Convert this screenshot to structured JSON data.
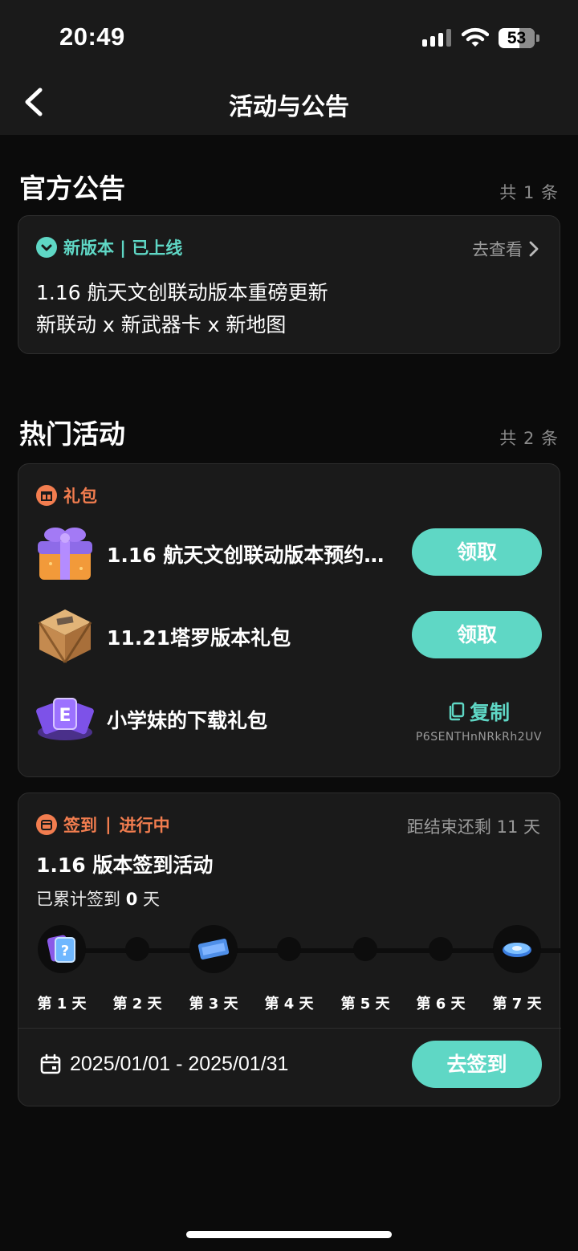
{
  "status_bar": {
    "time": "20:49",
    "battery": "53"
  },
  "header": {
    "title": "活动与公告"
  },
  "announcements": {
    "title": "官方公告",
    "count": "共 1 条",
    "card": {
      "tag": "新版本 | 已上线",
      "link": "去查看",
      "line1": "1.16 航天文创联动版本重磅更新",
      "line2": "新联动 x 新武器卡 x 新地图"
    }
  },
  "activities": {
    "title": "热门活动",
    "count": "共 2 条",
    "gift_card": {
      "tag": "礼包",
      "items": [
        {
          "name": "1.16 航天文创联动版本预约…",
          "action": "领取",
          "icon": "purple-gift-box-icon"
        },
        {
          "name": "11.21塔罗版本礼包",
          "action": "领取",
          "icon": "wooden-crate-icon"
        },
        {
          "name": "小学妹的下载礼包",
          "action": "复制",
          "code": "P6SENTHnNRkRh2UV",
          "icon": "purple-card-fan-icon"
        }
      ]
    },
    "checkin_card": {
      "tag": "签到",
      "status": "进行中",
      "remaining": "距结束还剩 11 天",
      "title": "1.16 版本签到活动",
      "accum_prefix": "已累计签到 ",
      "accum_days": "0",
      "accum_suffix": " 天",
      "days": [
        {
          "label": "第 1 天",
          "reward": "mystery-card"
        },
        {
          "label": "第 2 天",
          "reward": "none"
        },
        {
          "label": "第 3 天",
          "reward": "ticket-card"
        },
        {
          "label": "第 4 天",
          "reward": "none"
        },
        {
          "label": "第 5 天",
          "reward": "none"
        },
        {
          "label": "第 6 天",
          "reward": "none"
        },
        {
          "label": "第 7 天",
          "reward": "blue-coin"
        }
      ],
      "date_range": "2025/01/01 - 2025/01/31",
      "button": "去签到"
    }
  },
  "colors": {
    "accent": "#5fd7c5",
    "orange": "#f27d4f",
    "background": "#0b0b0b",
    "card": "#1a1a1a"
  }
}
